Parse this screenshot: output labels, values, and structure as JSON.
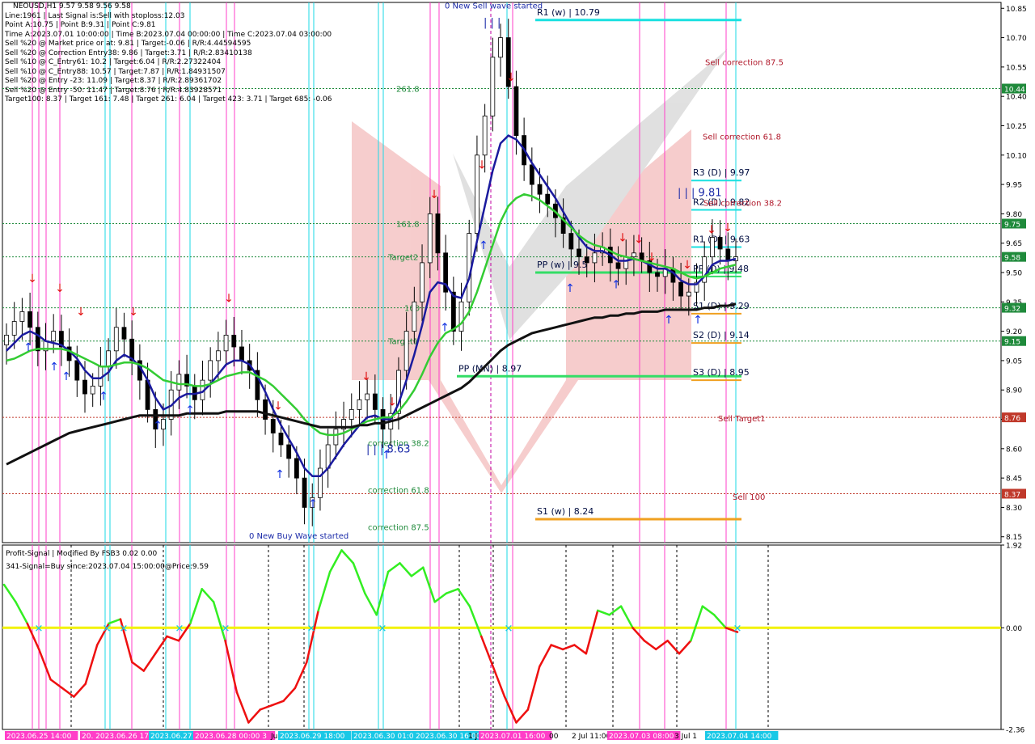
{
  "chart_data": [
    {
      "type": "candlestick",
      "symbol_header": "NEOUSD,H1  9.57 9.58 9.56 9.58",
      "info_lines": [
        "Line:1961 | Last Signal is:Sell with stoploss:12.03",
        "Point A:10.75 | Point B:9.31 | Point C:9.81",
        "Time A:2023.07.01 10:00:00 | Time B:2023.07.04 00:00:00 | Time C:2023.07.04 03:00:00",
        "Sell %20 @ Market price or at: 9.81 | Target:-0.06 | R/R:4.44594595",
        "Sell %20 @ Correction Entry38: 9.86 | Target:3.71 | R/R:2.83410138",
        "Sell %10 @ C_Entry61: 10.2 | Target:6.04 | R/R:2.27322404",
        "Sell %10 @ C_Entry88: 10.57 | Target:7.87 | R/R:1.84931507",
        "Sell %20 @ Entry -23: 11.09 | Target:8.37 | R/R:2.89361702",
        "Sell %20 @ Entry -50: 11.47 | Target:8.76 | R/R:4.83928571",
        "Target100: 8.37 | Target 161: 7.48 | Target 261: 6.04 | Target 423: 3.71 | Target 685: -0.06"
      ],
      "ylim": [
        8.12,
        10.88
      ],
      "y_ticks": [
        "10.85",
        "10.70",
        "10.55",
        "10.40",
        "10.25",
        "10.10",
        "9.95",
        "9.80",
        "9.65",
        "9.50",
        "9.35",
        "9.20",
        "9.05",
        "8.90",
        "8.75",
        "8.60",
        "8.45",
        "8.30",
        "8.15"
      ],
      "price_badges": [
        {
          "label": "10.44",
          "value": 10.44,
          "color": "#1f8a3b"
        },
        {
          "label": "9.75",
          "value": 9.75,
          "color": "#1f8a3b"
        },
        {
          "label": "9.58",
          "value": 9.58,
          "color": "#1f8a3b"
        },
        {
          "label": "9.32",
          "value": 9.32,
          "color": "#1f8a3b"
        },
        {
          "label": "9.15",
          "value": 9.15,
          "color": "#1f8a3b"
        },
        {
          "label": "8.76",
          "value": 8.76,
          "color": "#c0392b"
        },
        {
          "label": "8.37",
          "value": 8.37,
          "color": "#c0392b"
        }
      ],
      "pivot_levels": [
        {
          "label": "R1 (w) | 10.79",
          "value": 10.79,
          "color": "#19e0e0"
        },
        {
          "label": "R3 (D) | 9.97",
          "value": 9.97,
          "color": "#19e0e0"
        },
        {
          "label": "R2 (D) | 9.82",
          "value": 9.82,
          "color": "#19e0e0"
        },
        {
          "label": "R1 (D) | 9.63",
          "value": 9.63,
          "color": "#19e0e0"
        },
        {
          "label": "PP (w) | 9.5",
          "value": 9.5,
          "color": "#33dd66"
        },
        {
          "label": "PP (D) | 9.48",
          "value": 9.48,
          "color": "#33dd66"
        },
        {
          "label": "S1 (D) | 9.29",
          "value": 9.29,
          "color": "#f0a020"
        },
        {
          "label": "S2 (D) | 9.14",
          "value": 9.14,
          "color": "#f0a020"
        },
        {
          "label": "PP (MN) | 8.97",
          "value": 8.97,
          "color": "#33dd66"
        },
        {
          "label": "S3 (D) | 8.95",
          "value": 8.95,
          "color": "#f0a020"
        },
        {
          "label": "S1 (w) | 8.24",
          "value": 8.24,
          "color": "#f0a020"
        }
      ],
      "fib_labels": [
        {
          "label": "261.8",
          "value": 10.44
        },
        {
          "label": "161.8",
          "value": 9.75
        },
        {
          "label": "Target2",
          "value": 9.58
        },
        {
          "label": "100",
          "value": 9.32
        },
        {
          "label": "Target1",
          "value": 9.15
        },
        {
          "label": "correction 38.2",
          "value": 8.63
        },
        {
          "label": "correction 61.8",
          "value": 8.39
        },
        {
          "label": "correction 87.5",
          "value": 8.2
        }
      ],
      "sell_labels": [
        {
          "label": "Sell correction 87.5",
          "value": 10.56
        },
        {
          "label": "Sell correction 61.8",
          "value": 10.18
        },
        {
          "label": "Sell correction 38.2",
          "value": 9.84
        },
        {
          "label": "Sell Target1",
          "value": 8.74
        },
        {
          "label": "Sell 100",
          "value": 8.34
        }
      ],
      "wave_labels": [
        {
          "label": "0 New Sell wave started",
          "value": 10.85
        },
        {
          "label": "| | |",
          "value": 10.76
        },
        {
          "label": "| | | 9.81",
          "value": 9.89
        },
        {
          "label": "| | | 8.63",
          "value": 8.58
        },
        {
          "label": "0 New Buy Wave started",
          "value": 8.14
        }
      ],
      "series": [
        {
          "name": "Close",
          "values": [
            9.18,
            9.25,
            9.3,
            9.22,
            9.1,
            9.15,
            9.2,
            9.12,
            9.05,
            8.95,
            8.88,
            8.92,
            9.02,
            9.1,
            9.22,
            9.16,
            9.05,
            8.95,
            8.8,
            8.7,
            8.75,
            8.9,
            8.98,
            8.92,
            8.85,
            8.95,
            9.05,
            9.1,
            9.18,
            9.12,
            9.05,
            9.0,
            8.85,
            8.75,
            8.68,
            8.62,
            8.55,
            8.45,
            8.3,
            8.35,
            8.5,
            8.62,
            8.7,
            8.75,
            8.8,
            8.85,
            8.88,
            8.8,
            8.7,
            8.78,
            9.0,
            9.2,
            9.35,
            9.55,
            9.8,
            9.6,
            9.4,
            9.2,
            9.35,
            9.7,
            10.1,
            10.3,
            10.6,
            10.7,
            10.45,
            10.2,
            10.05,
            9.95,
            9.9,
            9.85,
            9.78,
            9.7,
            9.62,
            9.58,
            9.55,
            9.6,
            9.63,
            9.55,
            9.52,
            9.58,
            9.6,
            9.56,
            9.5,
            9.48,
            9.52,
            9.45,
            9.38,
            9.4,
            9.45,
            9.58,
            9.68,
            9.62,
            9.56,
            9.58
          ]
        },
        {
          "name": "MA fast",
          "values": [
            9.1,
            9.14,
            9.18,
            9.2,
            9.18,
            9.15,
            9.14,
            9.13,
            9.1,
            9.06,
            9.0,
            8.96,
            8.96,
            8.99,
            9.05,
            9.08,
            9.06,
            9.02,
            8.95,
            8.86,
            8.8,
            8.82,
            8.86,
            8.88,
            8.88,
            8.89,
            8.93,
            8.98,
            9.03,
            9.05,
            9.05,
            9.03,
            8.97,
            8.89,
            8.8,
            8.72,
            8.65,
            8.58,
            8.5,
            8.46,
            8.46,
            8.5,
            8.56,
            8.62,
            8.67,
            8.72,
            8.76,
            8.77,
            8.75,
            8.75,
            8.83,
            8.95,
            9.08,
            9.23,
            9.4,
            9.45,
            9.44,
            9.38,
            9.37,
            9.47,
            9.66,
            9.84,
            10.02,
            10.16,
            10.2,
            10.18,
            10.13,
            10.06,
            10.0,
            9.94,
            9.88,
            9.81,
            9.74,
            9.68,
            9.63,
            9.61,
            9.61,
            9.59,
            9.56,
            9.56,
            9.57,
            9.56,
            9.54,
            9.52,
            9.52,
            9.5,
            9.46,
            9.44,
            9.44,
            9.48,
            9.54,
            9.56,
            9.56,
            9.57
          ]
        },
        {
          "name": "MA mid",
          "values": [
            9.05,
            9.06,
            9.08,
            9.1,
            9.11,
            9.11,
            9.11,
            9.11,
            9.1,
            9.08,
            9.06,
            9.04,
            9.02,
            9.02,
            9.03,
            9.04,
            9.04,
            9.03,
            9.01,
            8.98,
            8.95,
            8.94,
            8.93,
            8.93,
            8.92,
            8.92,
            8.93,
            8.95,
            8.97,
            8.98,
            8.99,
            8.99,
            8.97,
            8.95,
            8.92,
            8.88,
            8.84,
            8.8,
            8.75,
            8.71,
            8.68,
            8.67,
            8.67,
            8.68,
            8.7,
            8.72,
            8.74,
            8.75,
            8.76,
            8.76,
            8.79,
            8.84,
            8.9,
            8.98,
            9.07,
            9.14,
            9.19,
            9.21,
            9.24,
            9.3,
            9.4,
            9.52,
            9.64,
            9.76,
            9.84,
            9.88,
            9.9,
            9.89,
            9.87,
            9.84,
            9.81,
            9.77,
            9.73,
            9.69,
            9.66,
            9.64,
            9.63,
            9.61,
            9.59,
            9.58,
            9.57,
            9.56,
            9.55,
            9.54,
            9.53,
            9.52,
            9.5,
            9.48,
            9.47,
            9.48,
            9.5,
            9.52,
            9.53,
            9.54
          ]
        },
        {
          "name": "MA slow",
          "values": [
            8.52,
            8.54,
            8.56,
            8.58,
            8.6,
            8.62,
            8.64,
            8.66,
            8.68,
            8.69,
            8.7,
            8.71,
            8.72,
            8.73,
            8.74,
            8.75,
            8.76,
            8.77,
            8.77,
            8.77,
            8.77,
            8.77,
            8.77,
            8.78,
            8.78,
            8.78,
            8.78,
            8.78,
            8.79,
            8.79,
            8.79,
            8.79,
            8.79,
            8.78,
            8.77,
            8.76,
            8.75,
            8.74,
            8.73,
            8.72,
            8.71,
            8.71,
            8.71,
            8.71,
            8.71,
            8.72,
            8.72,
            8.73,
            8.73,
            8.74,
            8.75,
            8.77,
            8.79,
            8.81,
            8.83,
            8.85,
            8.87,
            8.89,
            8.91,
            8.94,
            8.98,
            9.02,
            9.06,
            9.1,
            9.13,
            9.15,
            9.17,
            9.19,
            9.2,
            9.21,
            9.22,
            9.23,
            9.24,
            9.25,
            9.26,
            9.27,
            9.27,
            9.28,
            9.28,
            9.29,
            9.29,
            9.3,
            9.3,
            9.3,
            9.31,
            9.31,
            9.31,
            9.31,
            9.31,
            9.32,
            9.32,
            9.33,
            9.33,
            9.34
          ]
        }
      ]
    },
    {
      "type": "line",
      "title": "Profit-Signal | Modified By FSB3 0.02 0.00",
      "subtitle": "341-Signal=Buy since:2023.07.04 15:00:00@Price:9.59",
      "ylim": [
        -2.36,
        1.92
      ],
      "y_ticks": [
        "1.92",
        "0.00",
        "-2.36"
      ],
      "series": [
        {
          "name": "Profit-Signal",
          "values": [
            1.0,
            0.6,
            0.1,
            -0.5,
            -1.2,
            -1.4,
            -1.6,
            -1.3,
            -0.4,
            0.1,
            0.2,
            -0.8,
            -1.0,
            -0.6,
            -0.2,
            -0.3,
            0.1,
            0.9,
            0.6,
            -0.3,
            -1.5,
            -2.2,
            -1.9,
            -1.8,
            -1.7,
            -1.4,
            -0.8,
            0.4,
            1.3,
            1.8,
            1.5,
            0.8,
            0.3,
            1.3,
            1.5,
            1.2,
            1.4,
            0.6,
            0.8,
            0.9,
            0.5,
            -0.2,
            -0.9,
            -1.6,
            -2.2,
            -1.9,
            -0.9,
            -0.4,
            -0.5,
            -0.4,
            -0.6,
            0.4,
            0.3,
            0.5,
            0.0,
            -0.3,
            -0.5,
            -0.3,
            -0.6,
            -0.3,
            0.5,
            0.3,
            0.0,
            -0.1
          ]
        }
      ],
      "time_labels": [
        "2023.06.25 14:00",
        "20. 2023.06.26 17:00",
        "2023.06.27",
        "2023.06.28 00:00 3",
        "Jul",
        "2023.06.29 18:00",
        "2023.06.30 01:00",
        "2023.06.30 16:00",
        "1 J",
        "2023.07.01 16:00",
        "00",
        "2 Jul 11:00",
        "2023.07.03 08:00",
        "3 Jul 1",
        "2023.07.04 14:00"
      ]
    }
  ]
}
